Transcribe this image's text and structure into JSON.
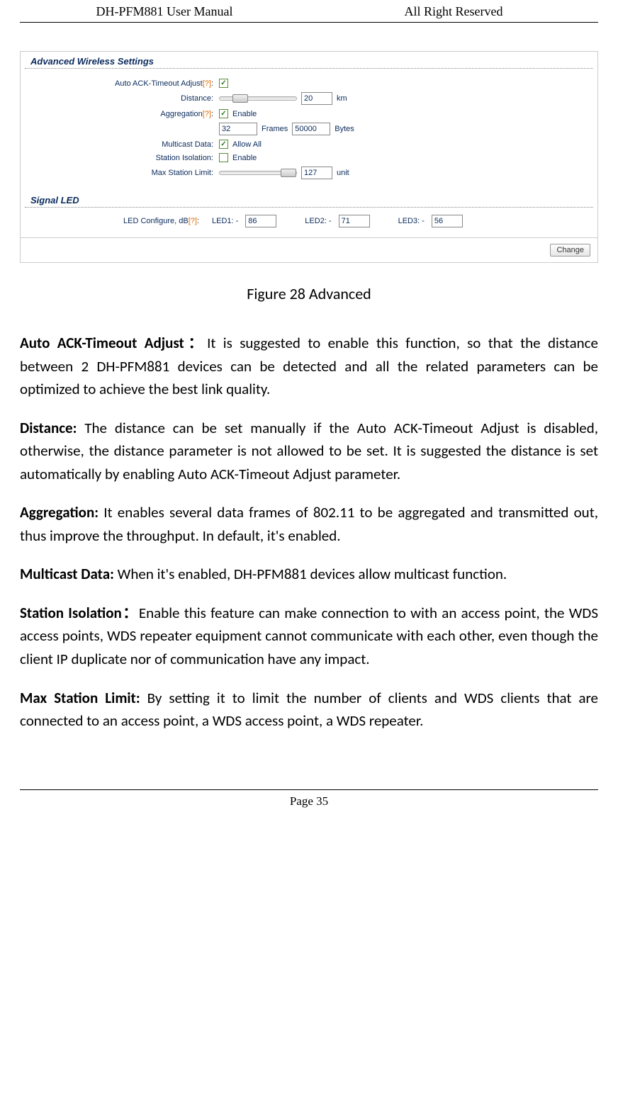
{
  "header": {
    "left": "DH-PFM881 User Manual",
    "right": "All Right Reserved"
  },
  "screenshot": {
    "section1_title": "Advanced Wireless Settings",
    "auto_ack": {
      "label": "Auto ACK-Timeout Adjust[?]:",
      "checked": true
    },
    "distance": {
      "label": "Distance:",
      "value": "20",
      "unit": "km"
    },
    "aggregation": {
      "label": "Aggregation[?]:",
      "checked": true,
      "checkbox_label": "Enable",
      "frames_value": "32",
      "frames_label": "Frames",
      "bytes_value": "50000",
      "bytes_label": "Bytes"
    },
    "multicast": {
      "label": "Multicast Data:",
      "checked": true,
      "checkbox_label": "Allow All"
    },
    "station_isolation": {
      "label": "Station Isolation:",
      "checked": false,
      "checkbox_label": "Enable"
    },
    "max_station": {
      "label": "Max Station Limit:",
      "value": "127",
      "unit": "unit"
    },
    "section2_title": "Signal LED",
    "led": {
      "label": "LED Configure, dB[?]:",
      "led1_label": "LED1: -",
      "led1_value": "86",
      "led2_label": "LED2: -",
      "led2_value": "71",
      "led3_label": "LED3: -",
      "led3_value": "56"
    },
    "change_button": "Change"
  },
  "figure_caption": "Figure 28 Advanced",
  "paragraphs": {
    "p1_bold": "Auto ACK-Timeout Adjust：",
    "p1_rest": "It is suggested to enable this function, so that the distance between 2 DH-PFM881 devices can be detected and all the related parameters can be optimized to achieve the best link quality.",
    "p2_bold": "Distance:",
    "p2_rest": " The distance can be set manually if the Auto ACK-Timeout Adjust is disabled, otherwise, the distance parameter is not allowed to be set. It is suggested the distance is set automatically by enabling Auto ACK-Timeout Adjust parameter.",
    "p3_bold": "Aggregation:",
    "p3_rest": " It enables several data frames of 802.11 to be aggregated and transmitted out, thus improve the throughput. In default, it's enabled.",
    "p4_bold": "Multicast Data: ",
    "p4_rest": " When it's enabled, DH-PFM881 devices allow multicast function.",
    "p5_bold": "Station Isolation：",
    "p5_rest": "Enable this feature can make connection to with an access point, the WDS access points, WDS repeater equipment cannot communicate with each other, even though the client IP duplicate nor of communication have any impact.",
    "p6_bold": "Max Station Limit: ",
    "p6_rest": " By setting it to limit the number of clients and WDS clients that are connected to an access point, a WDS access point, a WDS repeater."
  },
  "footer": "Page 35"
}
